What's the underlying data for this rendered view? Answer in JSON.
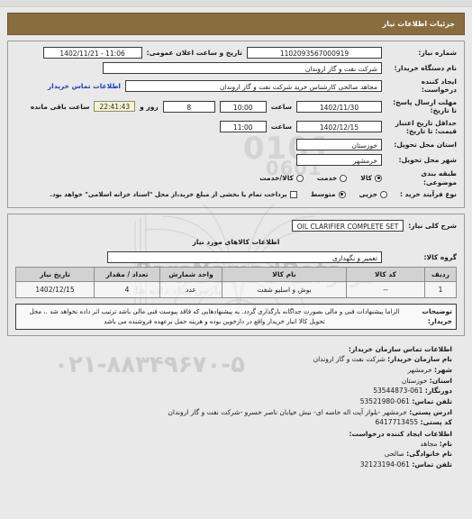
{
  "header": {
    "title": "جزئیات اطلاعات نیاز"
  },
  "form": {
    "need_number_label": "شماره نیاز:",
    "need_number_value": "1102093567000919",
    "announce_date_label": "تاریخ و ساعت اعلان عمومی:",
    "announce_date_value": "1402/11/21 - 11:06",
    "buyer_org_label": "نام دستگاه خریدار:",
    "buyer_org_value": "شرکت نفت و گاز اروندان",
    "creator_label": "ایجاد کننده درخواست:",
    "creator_value": "مجاهد صالحی کارشناس خرید شرکت نفت و گاز اروندان",
    "contact_link": "اطلاعات تماس خریدار",
    "deadline_label": "مهلت ارسال پاسخ: تا تاریخ:",
    "deadline_date": "1402/11/30",
    "hour_label": "ساعت",
    "deadline_time": "10:00",
    "days_value": "8",
    "days_label": "روز و",
    "countdown": "22:41:43",
    "remaining_label": "ساعت باقی مانده",
    "validity_label": "حداقل تاریخ اعتبار قیمت: تا تاریخ:",
    "validity_date": "1402/12/15",
    "validity_time": "11:00",
    "province_label": "استان محل تحویل:",
    "province_value": "خوزستان",
    "city_label": "شهر محل تحویل:",
    "city_value": "خرمشهر",
    "category_label": "طبقه بندی موضوعی:",
    "category_options": [
      {
        "label": "کالا",
        "selected": true
      },
      {
        "label": "خدمت",
        "selected": false
      },
      {
        "label": "کالا/خدمت",
        "selected": false
      }
    ],
    "process_label": "نوع فرآیند خرید :",
    "process_options": [
      {
        "label": "جزیی",
        "selected": false
      },
      {
        "label": "متوسط",
        "selected": true
      }
    ],
    "treasury_checkbox_label": "پرداخت تمام یا بخشی از مبلغ خرید،از محل \"اسناد خزانه اسلامی\" خواهد بود.",
    "treasury_checked": false
  },
  "details": {
    "summary_label": "شرح کلی نیاز:",
    "summary_value": "OIL CLARIFIER COMPLETE SET",
    "goods_info_heading": "اطلاعات کالاهای مورد نیاز",
    "group_label": "گروه کالا:",
    "group_value": "تعمیر و نگهداری"
  },
  "table": {
    "columns": [
      "ردیف",
      "کد کالا",
      "نام کالا",
      "واحد شمارش",
      "تعداد / مقدار",
      "تاریخ نیاز"
    ],
    "rows": [
      {
        "row": "1",
        "code": "--",
        "name": "بوش و اسلیو شفت",
        "unit": "عدد",
        "qty": "4",
        "date": "1402/12/15"
      }
    ]
  },
  "notes": {
    "label": "توضیحات خریدار:",
    "text": "الزاما پیشنهادات فنی و مالی بصورت جداگانه بارگذاری گردد. به پیشنهادهایی که فاقد پیوست فنی مالی باشد ترتیب اثر داده نخواهد شد .، محل تحویل کالا انبار خریدار واقع در دارخوین بوده و هزینه حمل برعهده فروشنده می باشد"
  },
  "contact": {
    "heading": "اطلاعات تماس سازمان خریدار:",
    "fields": [
      {
        "label": "نام سازمان خریدار:",
        "value": "شرکت نفت و گاز اروندان",
        "ltr": false
      },
      {
        "label": "شهر:",
        "value": "خرمشهر",
        "ltr": false
      },
      {
        "label": "استان:",
        "value": "خوزستان",
        "ltr": false
      },
      {
        "label": "دورنگار:",
        "value": "53544873-061",
        "ltr": true
      },
      {
        "label": "تلفن تماس:",
        "value": "53521980-061",
        "ltr": true
      },
      {
        "label": "ادرس پستی:",
        "value": "خرمشهر -بلوار آیت اله خامنه ای- نبش خیابان ناصر خسرو -شرکت نفت و گاز اروندان",
        "ltr": false
      },
      {
        "label": "کد پستی:",
        "value": "6417713455",
        "ltr": true
      }
    ],
    "creator_heading": "اطلاعات ایجاد کننده درخواست:",
    "creator_fields": [
      {
        "label": "نام:",
        "value": "مجاهد",
        "ltr": false
      },
      {
        "label": "نام خانوادگی:",
        "value": "صالحی",
        "ltr": false
      },
      {
        "label": "تلفن تماس:",
        "value": "32123194-061",
        "ltr": true
      }
    ]
  },
  "watermark": {
    "brand": "ParsNamadData",
    "persian": "مرکز اطلاعات مناقصات",
    "persian_sub": "پارس نماد داده ها",
    "phone": "۰۲۱-۸۸۳۴۹۶۷۰-۵",
    "digits": "0101",
    "digits2": "0601"
  },
  "colors": {
    "title_bar": "#8a6d3f",
    "link": "#1e3fbf",
    "timer_bg": "#f3f3d6",
    "page_bg": "#e9e9e9"
  }
}
